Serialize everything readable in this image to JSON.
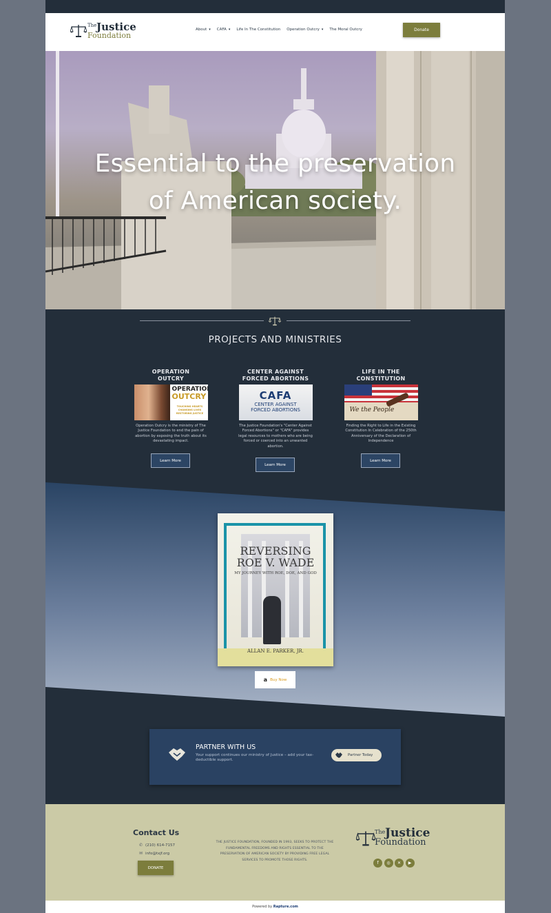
{
  "header": {
    "logo": {
      "the": "The",
      "justice": "Justice",
      "foundation": "Foundation"
    },
    "nav": [
      {
        "label": "About",
        "dropdown": true
      },
      {
        "label": "CAFA",
        "dropdown": true
      },
      {
        "label": "Life In The Constitution",
        "dropdown": false
      },
      {
        "label": "Operation Outcry",
        "dropdown": true
      },
      {
        "label": "The Moral Outcry",
        "dropdown": false
      }
    ],
    "donate_label": "Donate"
  },
  "hero": {
    "line1": "Essential to the preservation",
    "line2": "of American society."
  },
  "projects": {
    "title": "PROJECTS AND MINISTRIES",
    "cards": [
      {
        "title_line1": "OPERATION",
        "title_line2": "OUTCRY",
        "image_title": "OPERATION",
        "image_title2": "OUTCRY",
        "image_tagline": "TOUCHING HEARTS CHANGING LIVES RESTORING JUSTICE",
        "description": "Operation Outcry is the ministry of The Justice Foundation to end the pain of abortion by exposing the truth about its devastating impact.",
        "button": "Learn More"
      },
      {
        "title_line1": "CENTER AGAINST",
        "title_line2": "FORCED ABORTIONS",
        "image_title": "CAFA",
        "image_title2": "CENTER AGAINST",
        "image_tagline": "FORCED ABORTIONS",
        "description": "The Justice Foundation's \"Center Against Forced Abortions\" or \"CAFA\" provides legal resources to mothers who are being forced or coerced into an unwanted abortion.",
        "button": "Learn More"
      },
      {
        "title_line1": "LIFE IN THE",
        "title_line2": "CONSTITUTION",
        "image_title": "We the People",
        "description": "Finding the Right to Life in the Existing Constitution In Celebration of the 250th Anniversary of the Declaration of Independence",
        "button": "Learn More"
      }
    ]
  },
  "book": {
    "title_line1": "REVERSING",
    "title_line2": "ROE V. WADE",
    "subtitle": "MY JOURNEY WITH ROE, DOE, AND GOD",
    "author": "ALLAN E. PARKER, JR.",
    "buy_label": "Buy Now"
  },
  "partner": {
    "title": "PARTNER WITH US",
    "text": "Your support continues our ministry of Justice – add your tax-deductible support.",
    "button": "Partner Today"
  },
  "footer": {
    "contact_title": "Contact Us",
    "phone": "(210) 614-7157",
    "email": "info@txjf.org",
    "donate_label": "DONATE",
    "blurb": "THE JUSTICE FOUNDATION, FOUNDED IN 1993, SEEKS TO PROTECT THE FUNDAMENTAL FREEDOMS AND RIGHTS ESSENTIAL TO THE PRESERVATION OF AMERICAN SOCIETY BY PROVIDING FREE LEGAL SERVICES TO PROMOTE THOSE RIGHTS.",
    "logo": {
      "the": "The",
      "justice": "Justice",
      "foundation": "Foundation"
    },
    "socials": [
      "facebook-icon",
      "instagram-icon",
      "x-icon",
      "youtube-icon"
    ]
  },
  "powered": {
    "prefix": "Powered by",
    "brand": "Rapture.com"
  },
  "colors": {
    "navy": "#232e3a",
    "olive": "#7c7d3c",
    "footer_bg": "#cbcaa6",
    "partner_bg": "#2a4262"
  }
}
